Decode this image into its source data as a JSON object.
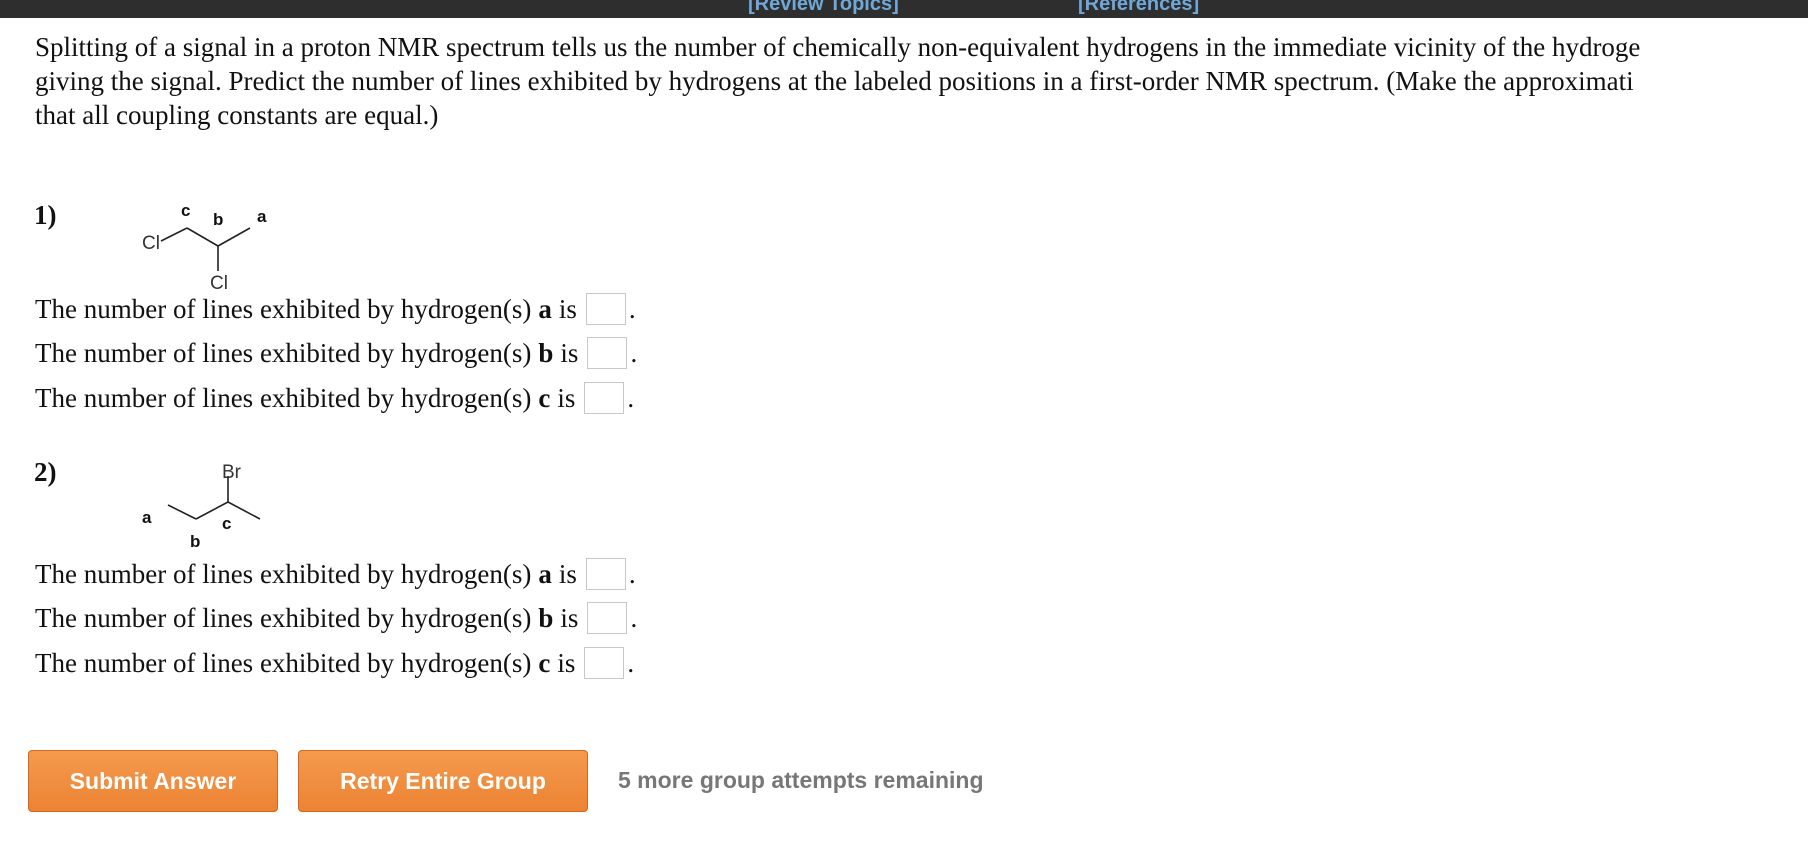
{
  "topbar": {
    "review_topics": "[Review Topics]",
    "references": "[References]"
  },
  "intro": {
    "line1": "Splitting of a signal in a proton NMR spectrum tells us the number of chemically non-equivalent hydrogens in the immediate vicinity of the hydroge",
    "line2": "giving the signal. Predict the number of lines exhibited by hydrogens at the labeled positions in a first-order NMR spectrum. (Make the approximati",
    "line3": "that all coupling constants are equal.)"
  },
  "questions": [
    {
      "number": "1)",
      "molecule_labels": {
        "a": "a",
        "b": "b",
        "c": "c",
        "cl1": "Cl",
        "cl2": "Cl"
      },
      "prompt": "The number of lines exhibited by hydrogen(s)",
      "is": "is",
      "period": ".",
      "items": [
        {
          "label": "a",
          "value": ""
        },
        {
          "label": "b",
          "value": ""
        },
        {
          "label": "c",
          "value": ""
        }
      ]
    },
    {
      "number": "2)",
      "molecule_labels": {
        "a": "a",
        "b": "b",
        "c": "c",
        "br": "Br"
      },
      "prompt": "The number of lines exhibited by hydrogen(s)",
      "is": "is",
      "period": ".",
      "items": [
        {
          "label": "a",
          "value": ""
        },
        {
          "label": "b",
          "value": ""
        },
        {
          "label": "c",
          "value": ""
        }
      ]
    }
  ],
  "actions": {
    "submit": "Submit Answer",
    "retry": "Retry Entire Group",
    "attempts": "5 more group attempts remaining"
  },
  "colors": {
    "button": "#ee8a3c",
    "link": "#6fa8d8",
    "topbar": "#2e2e2e"
  }
}
